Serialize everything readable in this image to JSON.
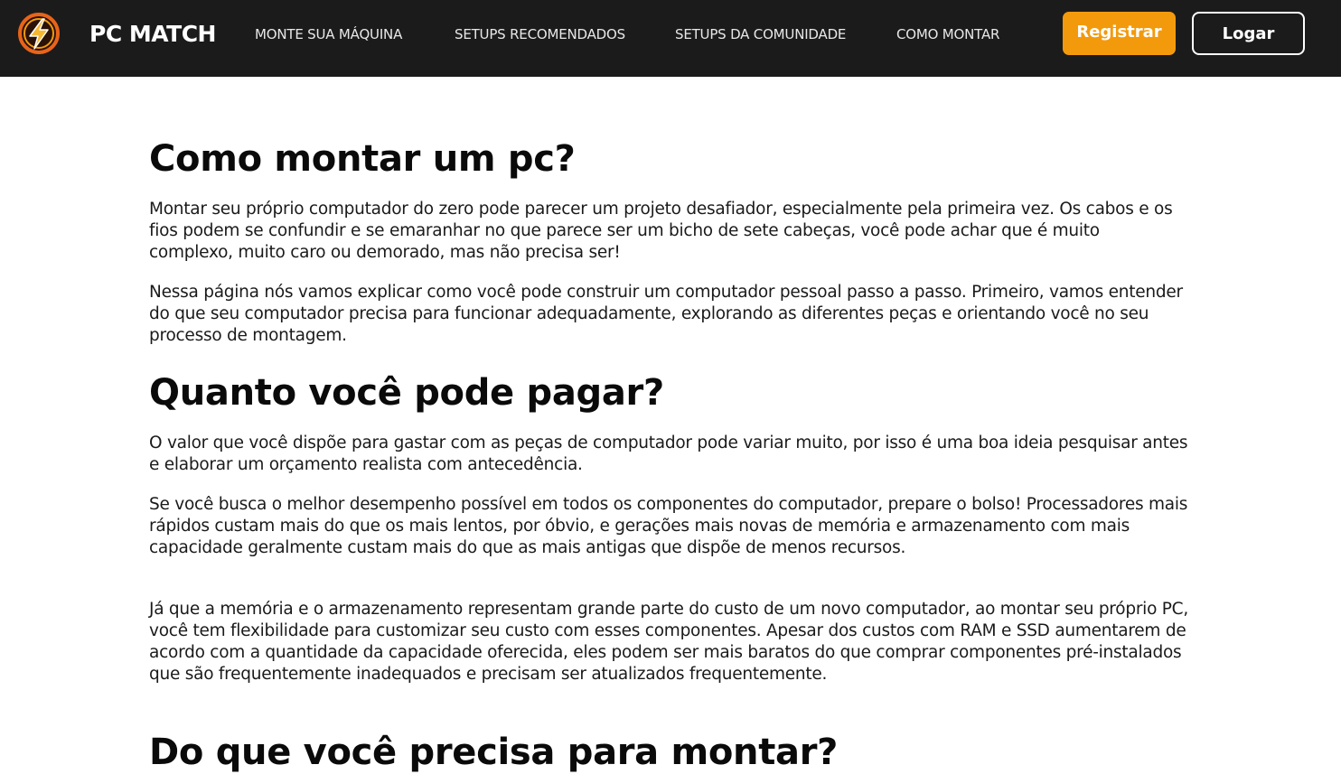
{
  "navbar": {
    "brand": "PC MATCH",
    "links": [
      "MONTE SUA MÁQUINA",
      "SETUPS RECOMENDADOS",
      "SETUPS DA COMUNIDADE",
      "COMO MONTAR"
    ],
    "register_label": "Registrar",
    "login_label": "Logar",
    "accent_color": "#f39a0c",
    "background_color": "#1b1b1b"
  },
  "sections": [
    {
      "title": "Como montar um pc?",
      "paragraphs": [
        "Montar seu próprio computador do zero pode parecer um projeto desafiador, especialmente pela primeira vez. Os cabos e os fios podem se confundir e se emaranhar no que parece ser um bicho de sete cabeças, você pode achar que é muito complexo, muito caro ou demorado, mas não precisa ser!",
        "Nessa página nós vamos explicar como você pode construir um computador pessoal passo a passo. Primeiro, vamos entender do que seu computador precisa para funcionar adequadamente, explorando as diferentes peças e orientando você no seu processo de montagem."
      ]
    },
    {
      "title": "Quanto você pode pagar?",
      "paragraphs": [
        "O valor que você dispõe para gastar com as peças de computador pode variar muito, por isso é uma boa ideia pesquisar antes e elaborar um orçamento realista com antecedência.",
        "Se você busca o melhor desempenho possível em todos os componentes do computador, prepare o bolso! Processadores mais rápidos custam mais do que os mais lentos, por óbvio, e gerações mais novas de memória e armazenamento com mais capacidade geralmente custam mais do que as mais antigas que dispõe de menos recursos.",
        "Já que a memória e o armazenamento representam grande parte do custo de um novo computador, ao montar seu próprio PC, você tem flexibilidade para customizar seu custo com esses componentes. Apesar dos custos com RAM e SSD aumentarem de acordo com a quantidade da capacidade oferecida, eles podem ser mais baratos do que comprar componentes pré-instalados que são frequentemente inadequados e precisam ser atualizados frequentemente."
      ]
    },
    {
      "title": "Do que você precisa para montar?",
      "paragraphs": []
    }
  ]
}
